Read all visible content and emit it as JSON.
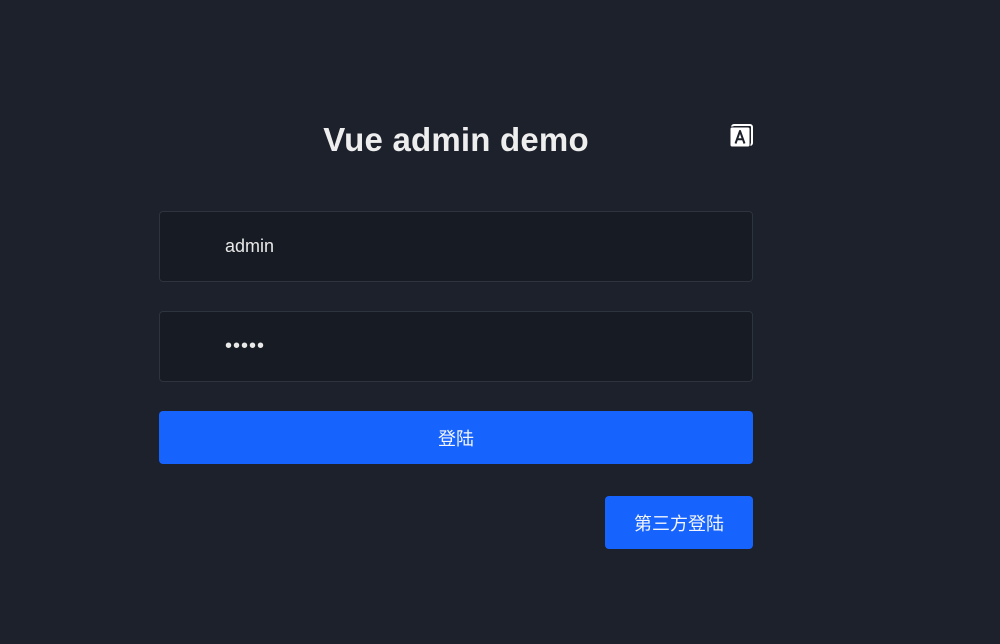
{
  "login": {
    "title": "Vue admin demo",
    "language_icon": "translate-icon",
    "username": {
      "value": "admin"
    },
    "password": {
      "value": "admin"
    },
    "login_button": "登陆",
    "third_party_button": "第三方登陆"
  },
  "colors": {
    "background": "#1c212b",
    "input_background": "#171b23",
    "input_border": "#2e343e",
    "primary": "#1763fe",
    "title_text": "#eeeeee"
  }
}
